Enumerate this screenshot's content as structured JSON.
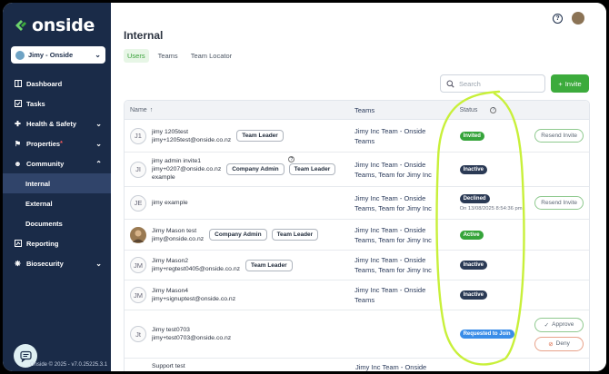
{
  "brand": {
    "name": "onside",
    "accent": "#3cab3c",
    "sidebar_bg": "#1a2b48"
  },
  "sidebar": {
    "org_selector": "Jimy - Onside",
    "items": [
      {
        "label": "Dashboard",
        "icon": "dashboard-icon"
      },
      {
        "label": "Tasks",
        "icon": "tasks-icon"
      },
      {
        "label": "Health & Safety",
        "icon": "health-icon",
        "expandable": true
      },
      {
        "label": "Properties",
        "icon": "properties-icon",
        "expandable": true,
        "badge": "*"
      },
      {
        "label": "Community",
        "icon": "community-icon",
        "expandable": true,
        "expanded": true
      },
      {
        "label": "Internal",
        "sub": true,
        "active": true
      },
      {
        "label": "External",
        "sub": true
      },
      {
        "label": "Documents",
        "sub": true
      },
      {
        "label": "Reporting",
        "icon": "reporting-icon"
      },
      {
        "label": "Biosecurity",
        "icon": "biosecurity-icon",
        "expandable": true
      }
    ],
    "footer": "Onside © 2025 - v7.0.25225.3.1"
  },
  "page": {
    "title": "Internal",
    "tabs": [
      "Users",
      "Teams",
      "Team Locator"
    ],
    "active_tab": "Users",
    "search_placeholder": "Search",
    "invite_label": "Invite"
  },
  "table": {
    "headers": {
      "name": "Name",
      "teams": "Teams",
      "status": "Status"
    },
    "rows": [
      {
        "initials": "J1",
        "name": "jimy 1205test",
        "email": "jimy+1205test@onside.co.nz",
        "roles": [
          "Team Leader"
        ],
        "teams": [
          "Jimy Inc Team - Onside",
          "Teams"
        ],
        "status": "Invited",
        "status_color": "green",
        "actions": [
          "Resend Invite"
        ]
      },
      {
        "initials": "JI",
        "name": "jimy admin invite1",
        "email": "jimy+0207@onside.co.nz",
        "extra": "example",
        "roles": [
          "Company Admin",
          "Team Leader"
        ],
        "info": "?",
        "teams": [
          "Jimy Inc Team - Onside",
          "Teams, Team for Jimy Inc"
        ],
        "status": "Inactive",
        "status_color": "navy",
        "actions": []
      },
      {
        "initials": "JE",
        "name": "jimy example",
        "email": "",
        "roles": [],
        "teams": [
          "Jimy Inc Team - Onside",
          "Teams, Team for Jimy Inc"
        ],
        "status": "Declined",
        "status_color": "navy",
        "status_note": "On 13/08/2025 8:54:36 pm",
        "actions": [
          "Resend Invite"
        ]
      },
      {
        "initials": "",
        "photo": true,
        "name": "Jimy Mason test",
        "email": "jimy@onside.co.nz",
        "roles": [
          "Company Admin",
          "Team Leader"
        ],
        "teams": [
          "Jimy Inc Team - Onside",
          "Teams, Team for Jimy Inc"
        ],
        "status": "Active",
        "status_color": "green",
        "actions": []
      },
      {
        "initials": "JM",
        "name": "Jimy Mason2",
        "email": "jimy+regtest0405@onside.co.nz",
        "roles": [
          "Team Leader"
        ],
        "teams": [
          "Jimy Inc Team - Onside",
          "Teams, Team for Jimy Inc"
        ],
        "status": "Inactive",
        "status_color": "navy",
        "actions": []
      },
      {
        "initials": "JM",
        "name": "Jimy Mason4",
        "email": "jimy+signuptest@onside.co.nz",
        "roles": [],
        "teams": [
          "Jimy Inc Team - Onside",
          "Teams"
        ],
        "status": "Inactive",
        "status_color": "navy",
        "actions": []
      },
      {
        "initials": "Jt",
        "name": "Jimy test0703",
        "email": "jimy+test0703@onside.co.nz",
        "roles": [],
        "teams": [],
        "status": "Requested to Join",
        "status_color": "blue",
        "actions": [
          "Approve",
          "Deny"
        ]
      },
      {
        "initials": "",
        "name": "Support test",
        "email": "",
        "roles": [],
        "teams": [
          "Jimy Inc Team - Onside"
        ],
        "status": "",
        "actions": []
      }
    ]
  }
}
